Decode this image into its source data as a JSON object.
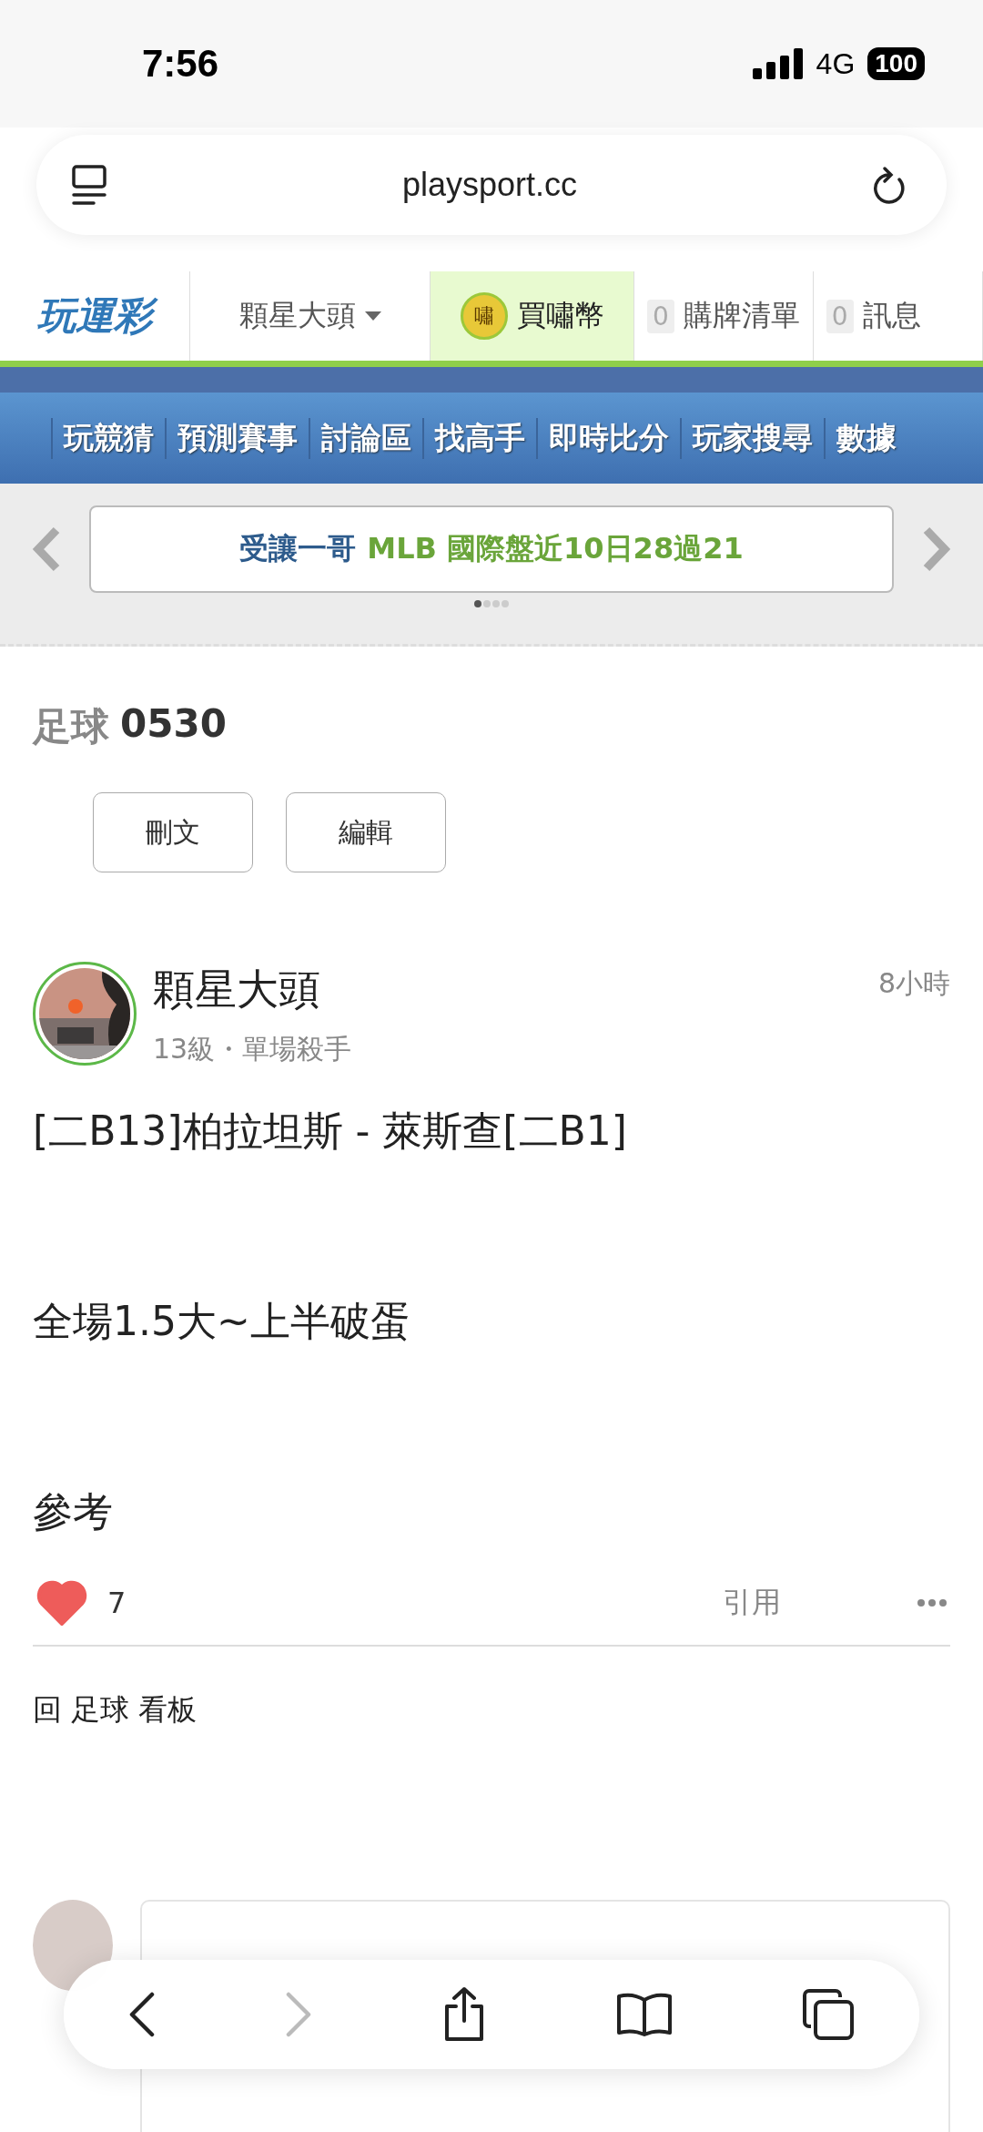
{
  "status_bar": {
    "time": "7:56",
    "network": "4G",
    "battery": "100"
  },
  "browser": {
    "url": "playsport.cc"
  },
  "site_header": {
    "logo": "玩運彩",
    "user_menu": "顆星大頭",
    "coin_button": "買嘯幣",
    "coin_badge": "嘯",
    "counters": [
      {
        "count": "0",
        "label": "購牌清單"
      },
      {
        "count": "0",
        "label": "訊息"
      }
    ]
  },
  "main_nav": [
    "玩競猜",
    "預測賽事",
    "討論區",
    "找高手",
    "即時比分",
    "玩家搜尋",
    "數據"
  ],
  "banner": {
    "name": "受讓一哥",
    "text": "MLB 國際盤近10日28過21",
    "pages": [
      {
        "selected": true
      },
      {
        "selected": false
      },
      {
        "selected": false
      },
      {
        "selected": false
      }
    ]
  },
  "thread": {
    "board": "足球",
    "title": "0530",
    "actions": [
      "刪文",
      "編輯"
    ]
  },
  "post": {
    "author": "顆星大頭",
    "meta": "13級・單場殺手",
    "time": "8小時",
    "paragraphs": [
      "[二B13]柏拉坦斯 - 萊斯查[二B1]",
      "全場1.5大~上半破蛋",
      "參考"
    ],
    "likes": "7",
    "liked": true,
    "quote": "引用"
  },
  "back_link": "回 足球 看板"
}
